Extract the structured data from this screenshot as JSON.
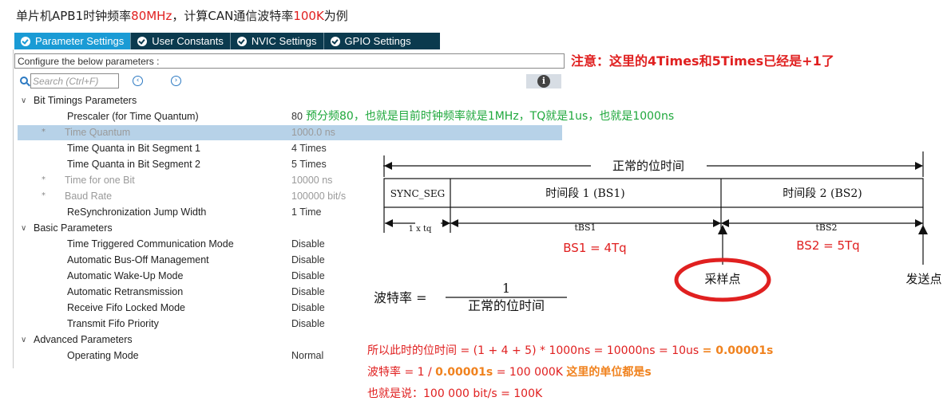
{
  "title": {
    "prefix": "单片机APB1时钟频率",
    "freq": "80MHz",
    "middle": "，计算CAN通信波特率",
    "baud": "100K",
    "suffix": "为例"
  },
  "tabs": [
    {
      "label": "Parameter Settings",
      "active": true
    },
    {
      "label": "User Constants",
      "active": false
    },
    {
      "label": "NVIC Settings",
      "active": false
    },
    {
      "label": "GPIO Settings",
      "active": false
    }
  ],
  "config_label": "Configure the below parameters :",
  "search": {
    "placeholder": "Search (Ctrl+F)"
  },
  "groups": {
    "bit_timings": "Bit Timings Parameters",
    "basic": "Basic Parameters",
    "advanced": "Advanced Parameters"
  },
  "params": {
    "prescaler": {
      "label": "Prescaler (for Time Quantum)",
      "value": "80"
    },
    "time_quantum": {
      "label": "Time Quantum",
      "value": "1000.0 ns"
    },
    "bs1": {
      "label": "Time Quanta in Bit Segment 1",
      "value": "4 Times"
    },
    "bs2": {
      "label": "Time Quanta in Bit Segment 2",
      "value": "5 Times"
    },
    "time_one_bit": {
      "label": "Time for one Bit",
      "value": "10000 ns"
    },
    "baud_rate": {
      "label": "Baud Rate",
      "value": "100000 bit/s"
    },
    "sjw": {
      "label": "ReSynchronization Jump Width",
      "value": "1 Time"
    },
    "ttcm": {
      "label": "Time Triggered Communication Mode",
      "value": "Disable"
    },
    "abom": {
      "label": "Automatic Bus-Off Management",
      "value": "Disable"
    },
    "awum": {
      "label": "Automatic Wake-Up Mode",
      "value": "Disable"
    },
    "art": {
      "label": "Automatic Retransmission",
      "value": "Disable"
    },
    "rflm": {
      "label": "Receive Fifo Locked Mode",
      "value": "Disable"
    },
    "txfp": {
      "label": "Transmit Fifo Priority",
      "value": "Disable"
    },
    "mode": {
      "label": "Operating Mode",
      "value": "Normal"
    }
  },
  "annotations": {
    "note": "注意：这里的4Times和5Times已经是+1了",
    "prescaler_note": "预分频80，也就是目前时钟频率就是1MHz，TQ就是1us，也就是1000ns",
    "bs1_eq": "BS1 = 4Tq",
    "bs2_eq": "BS2 = 5Tq",
    "calc1_a": "所以此时的位时间 = (1 + 4 + 5)  * 1000ns = 10000ns = 10us ",
    "calc1_b": "= 0.00001s",
    "calc2_a": "波特率 = 1 / ",
    "calc2_b": "0.00001s",
    "calc2_c": " = 100 000K  ",
    "calc2_d": "这里的单位都是s",
    "calc3": "也就是说：100 000 bit/s = 100K"
  },
  "diagram": {
    "normal_bit_time": "正常的位时间",
    "sync_seg": "SYNC_SEG",
    "seg1": "时间段 1 (BS1)",
    "seg2": "时间段 2 (BS2)",
    "tq": "1 x tq",
    "tbs1": "tBS1",
    "tbs2": "tBS2",
    "sample_point": "采样点",
    "transmit_point": "发送点",
    "formula_lhs": "波特率 =",
    "formula_num": "1",
    "formula_den": "正常的位时间"
  },
  "colors": {
    "tab_bar": "#0b3a4e",
    "tab_active": "#1a9bd5",
    "highlight": "#b7d2e8",
    "red": "#e02020",
    "green": "#1fa83c",
    "orange": "#f0821e"
  }
}
